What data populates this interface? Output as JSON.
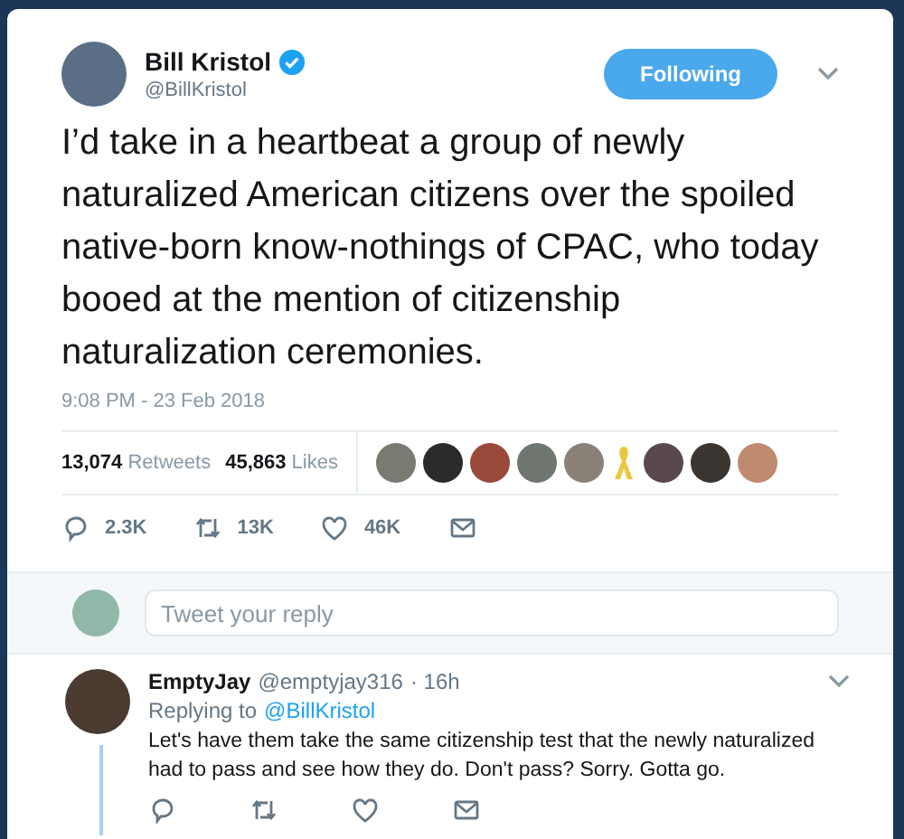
{
  "tweet": {
    "name": "Bill Kristol",
    "verified": true,
    "handle": "@BillKristol",
    "follow_button": "Following",
    "text": "I’d take in a heartbeat a group of newly naturalized American citizens over the spoiled native-born know-nothings of CPAC, who today booed at the mention of citizenship naturalization ceremonies.",
    "timestamp": "9:08 PM - 23 Feb 2018",
    "stats": [
      {
        "count": "13,074",
        "label": "Retweets"
      },
      {
        "count": "45,863",
        "label": "Likes"
      }
    ],
    "likers": [
      {
        "kind": "avatar"
      },
      {
        "kind": "avatar"
      },
      {
        "kind": "avatar"
      },
      {
        "kind": "avatar"
      },
      {
        "kind": "avatar"
      },
      {
        "kind": "ribbon"
      },
      {
        "kind": "avatar"
      },
      {
        "kind": "avatar"
      },
      {
        "kind": "avatar"
      }
    ],
    "actions": [
      {
        "kind": "reply",
        "count": "2.3K"
      },
      {
        "kind": "retweet",
        "count": "13K"
      },
      {
        "kind": "like",
        "count": "46K"
      },
      {
        "kind": "message"
      }
    ]
  },
  "reply_box": {
    "placeholder": "Tweet your reply"
  },
  "reply": {
    "name": "EmptyJay",
    "handle": "@emptyjay316",
    "time": "· 16h",
    "replying_label": "Replying to",
    "mention": "@BillKristol",
    "text": "Let's have them take the same citizenship test that the newly naturalized had to pass and see how they do. Don't pass? Sorry. Gotta go.",
    "actions": [
      {
        "kind": "reply"
      },
      {
        "kind": "retweet"
      },
      {
        "kind": "like"
      },
      {
        "kind": "message"
      }
    ]
  }
}
